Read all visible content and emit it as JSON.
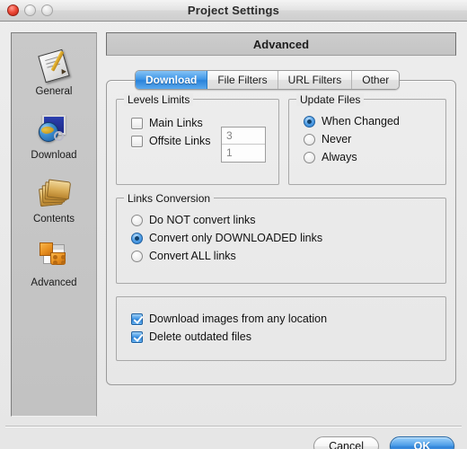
{
  "window": {
    "title": "Project Settings",
    "traffic_lights": [
      {
        "name": "close-button",
        "color": "#ef4b3a"
      },
      {
        "name": "minimize-button",
        "color": "#e2e2e2"
      },
      {
        "name": "zoom-button",
        "color": "#e2e2e2"
      }
    ]
  },
  "sidebar": {
    "items": [
      {
        "label": "General",
        "icon": "clipboard-pencil-icon",
        "selected": false
      },
      {
        "label": "Download",
        "icon": "globe-image-icon",
        "selected": false
      },
      {
        "label": "Contents",
        "icon": "folders-icon",
        "selected": false
      },
      {
        "label": "Advanced",
        "icon": "puzzle-window-icon",
        "selected": true
      }
    ]
  },
  "pane": {
    "header": "Advanced"
  },
  "tabs": [
    {
      "label": "Download",
      "active": true
    },
    {
      "label": "File Filters",
      "active": false
    },
    {
      "label": "URL Filters",
      "active": false
    },
    {
      "label": "Other",
      "active": false
    }
  ],
  "groups": {
    "levels_limits": {
      "legend": "Levels Limits",
      "checkboxes": [
        {
          "label": "Main Links",
          "checked": false
        },
        {
          "label": "Offsite Links",
          "checked": false
        }
      ],
      "fields": [
        {
          "name": "main-links-value",
          "value": "3"
        },
        {
          "name": "offsite-links-value",
          "value": "1"
        }
      ]
    },
    "update_files": {
      "legend": "Update Files",
      "options": [
        {
          "label": "When Changed",
          "selected": true
        },
        {
          "label": "Never",
          "selected": false
        },
        {
          "label": "Always",
          "selected": false
        }
      ]
    },
    "links_conversion": {
      "legend": "Links Conversion",
      "options": [
        {
          "label": "Do NOT convert links",
          "selected": false
        },
        {
          "label": "Convert only DOWNLOADED links",
          "selected": true
        },
        {
          "label": "Convert ALL links",
          "selected": false
        }
      ]
    },
    "flags": {
      "checkboxes": [
        {
          "label": "Download images from any location",
          "checked": true
        },
        {
          "label": "Delete outdated files",
          "checked": true
        }
      ]
    }
  },
  "buttons": {
    "cancel": "Cancel",
    "ok": "OK"
  },
  "colors": {
    "accent": "#2b7fd2",
    "window_bg": "#e9e9e9",
    "sidebar_bg": "#c6c6c6"
  }
}
